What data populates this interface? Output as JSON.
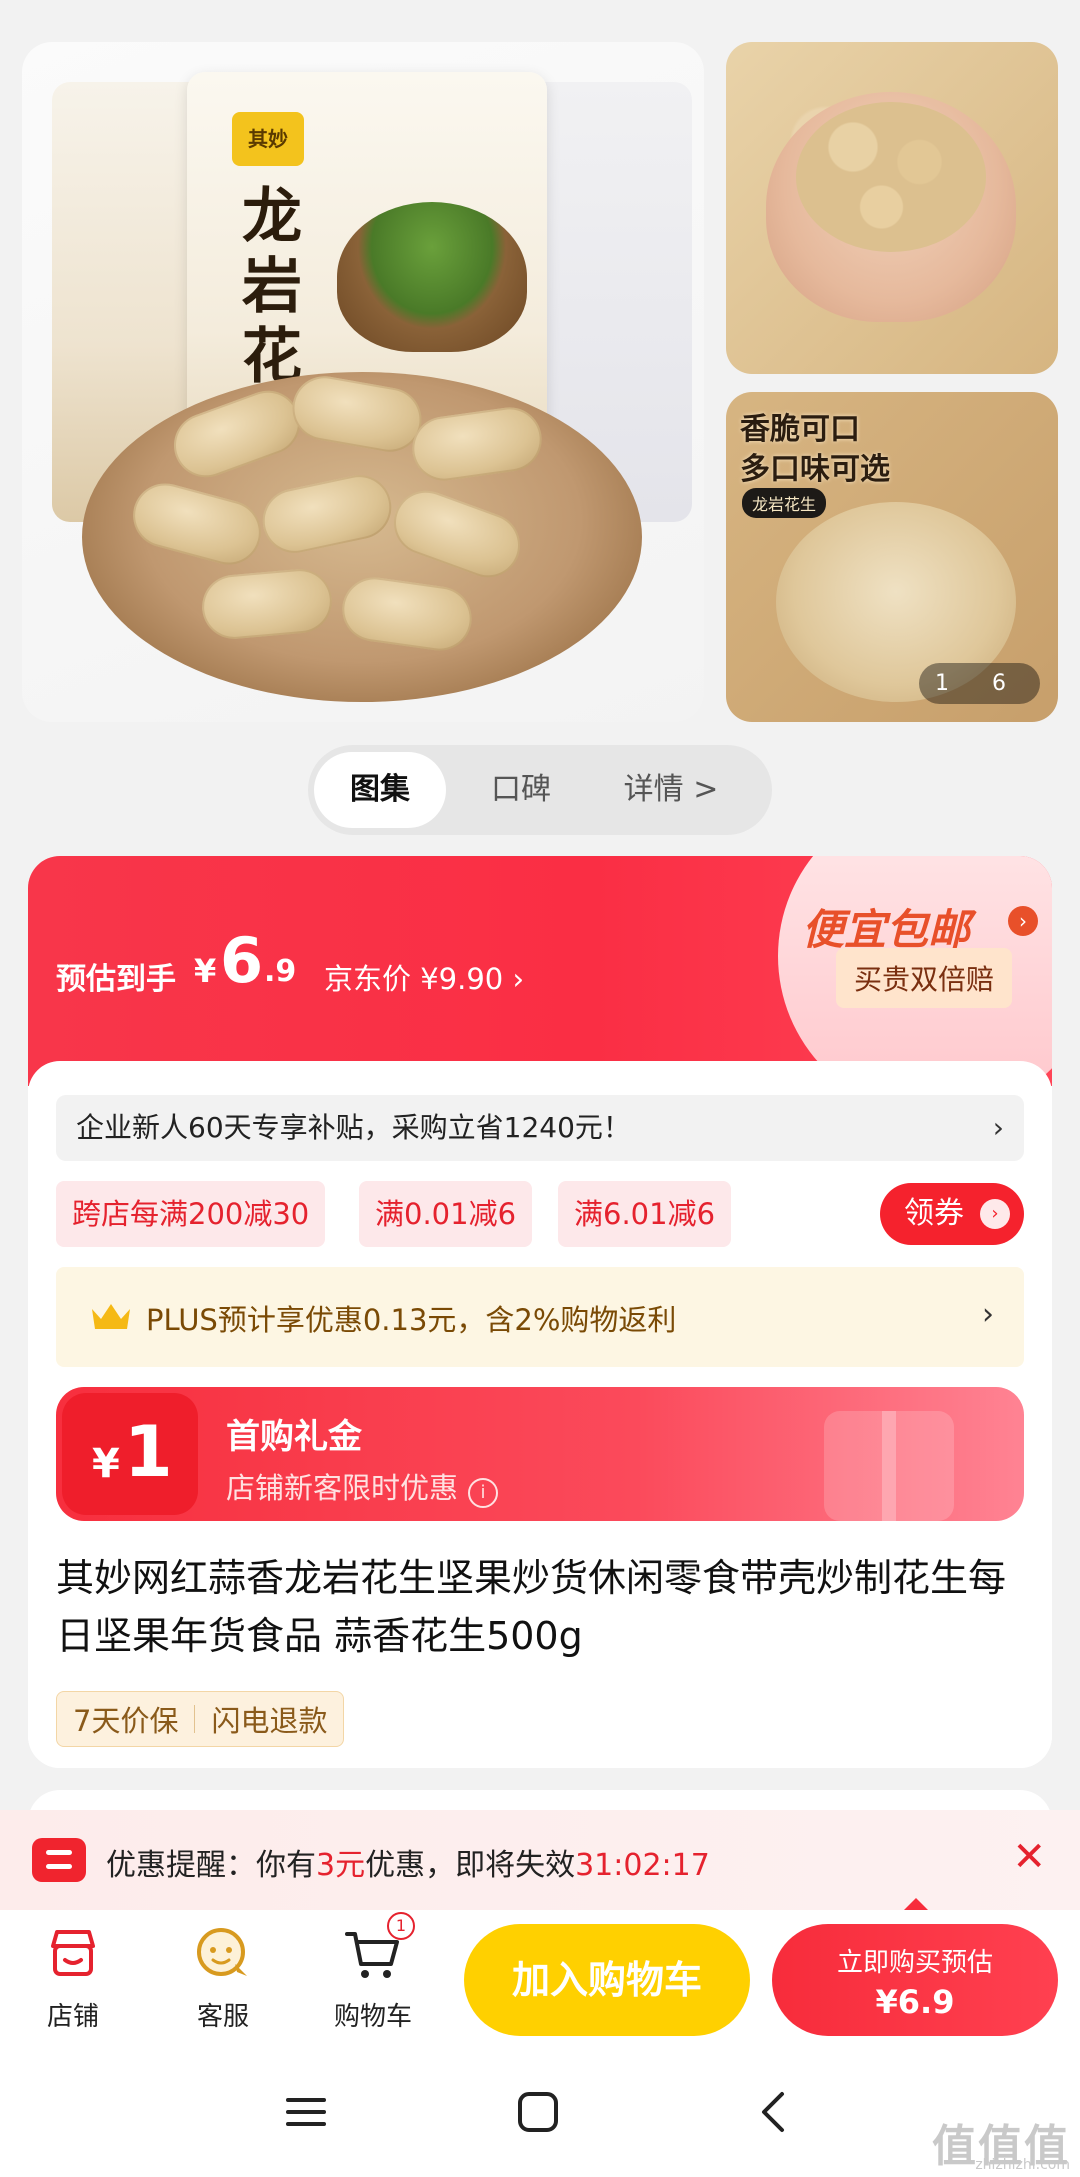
{
  "gallery": {
    "main_image_alt": "",
    "bag_logo": "其妙",
    "bag_title": "龙岩花生",
    "side_image_2_text_line1": "香脆可口",
    "side_image_2_text_line2": "多口味可选",
    "side_image_2_tag": "龙岩花生",
    "image_counter": "1 6"
  },
  "tabs": [
    {
      "label": "图集",
      "active": true
    },
    {
      "label": "口碑",
      "active": false
    },
    {
      "label": "详情 >",
      "active": false
    }
  ],
  "price": {
    "estimate_label": "预估到手",
    "currency": "¥",
    "estimate_int": "6",
    "estimate_dec": ".9",
    "jd_price_label": "京东价 ¥9.90",
    "jd_price_chevron": "›",
    "promo_title": "便宜包邮",
    "promo_arrow": "›",
    "promo_badge": "买贵双倍赔"
  },
  "notice": {
    "text": "企业新人60天专享补贴，采购立省1240元！",
    "chevron": "›"
  },
  "coupons": [
    {
      "label": "跨店每满200减30"
    },
    {
      "label": "满0.01减6"
    },
    {
      "label": "满6.01减6"
    }
  ],
  "claim_button": {
    "label": "领券",
    "icon": "›"
  },
  "plus": {
    "text": "PLUS预计享优惠0.13元，含2%购物返利",
    "chevron": "›"
  },
  "gift": {
    "currency": "¥",
    "amount": "1",
    "title": "首购礼金",
    "subtitle": "店铺新客限时优惠",
    "info_icon": "i"
  },
  "product": {
    "title": "其妙网红蒜香龙岩花生坚果炒货休闲零食带壳炒制花生每日坚果年货食品 蒜香花生500g",
    "service_tags": [
      "7天价保",
      "闪电退款"
    ]
  },
  "reminder": {
    "prefix": "优惠提醒：你有",
    "amount": "3元",
    "middle": "优惠，即将失效",
    "countdown": "31:02:17",
    "close": "✕"
  },
  "actions": {
    "store_label": "店铺",
    "service_label": "客服",
    "cart_label": "购物车",
    "cart_count": "1",
    "add_cart_label": "加入购物车",
    "buy_now_line1": "立即购买预估",
    "buy_now_line2": "¥6.9"
  },
  "watermark": {
    "text": "值值值",
    "sub": "zhizhizhi.com"
  },
  "colors": {
    "accent_red": "#f5222d",
    "cart_yellow": "#ffd000",
    "plus_gold": "#7a4a05"
  }
}
